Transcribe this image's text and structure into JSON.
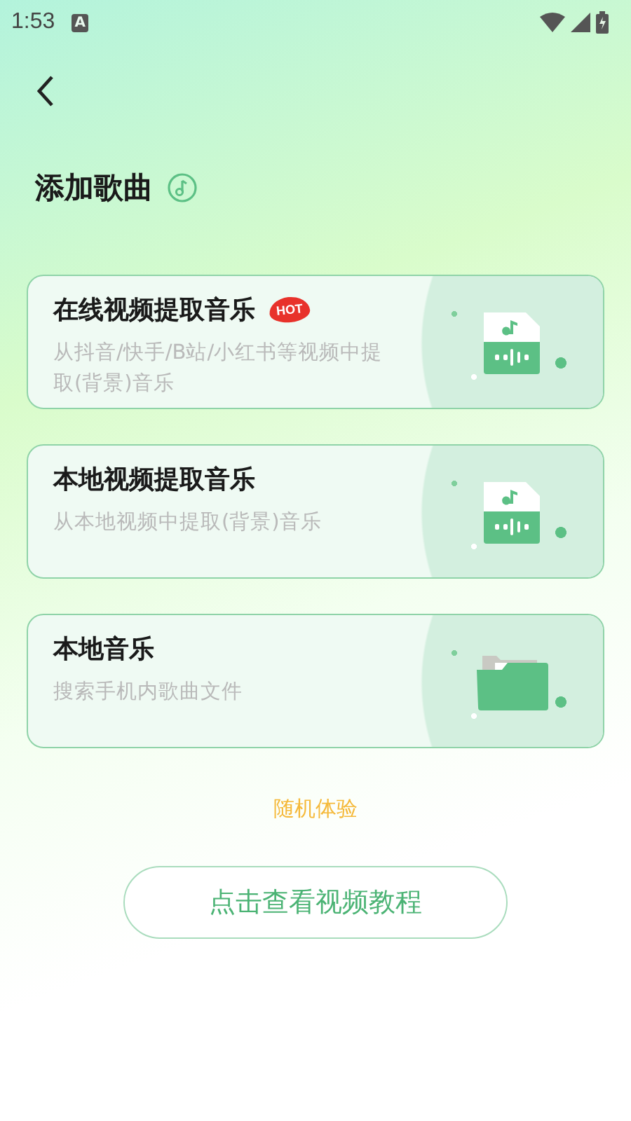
{
  "status_bar": {
    "time": "1:53",
    "keyboard_indicator": "A"
  },
  "header": {
    "title": "添加歌曲"
  },
  "options": [
    {
      "kind": "online-video",
      "title": "在线视频提取音乐",
      "badge": "HOT",
      "subtitle": "从抖音/快手/B站/小红书等视频中提取(背景)音乐"
    },
    {
      "kind": "local-video",
      "title": "本地视频提取音乐",
      "subtitle": "从本地视频中提取(背景)音乐"
    },
    {
      "kind": "local-music",
      "title": "本地音乐",
      "subtitle": "搜索手机内歌曲文件"
    }
  ],
  "random_link": "随机体验",
  "tutorial_button": "点击查看视频教程"
}
